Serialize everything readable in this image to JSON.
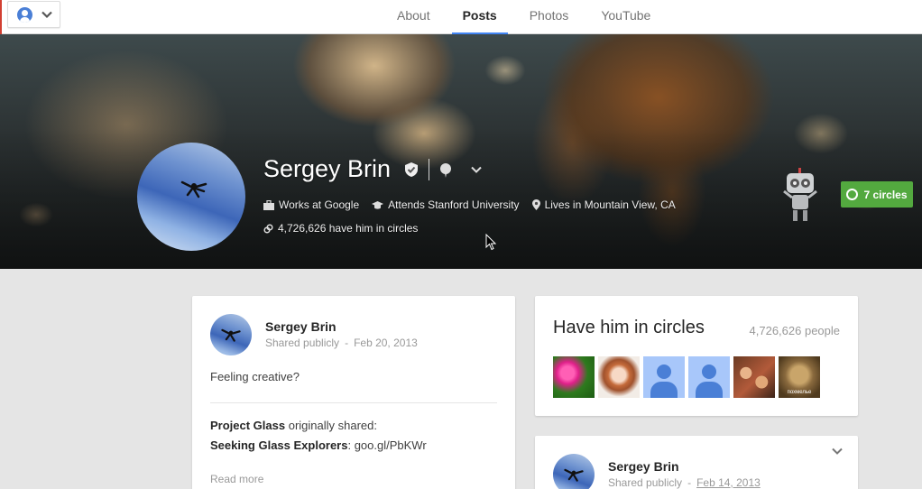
{
  "nav": {
    "tabs": [
      {
        "label": "About"
      },
      {
        "label": "Posts",
        "active": true
      },
      {
        "label": "Photos"
      },
      {
        "label": "YouTube"
      }
    ]
  },
  "profile": {
    "name": "Sergey Brin",
    "work": "Works at Google",
    "school": "Attends Stanford University",
    "location": "Lives in Mountain View, CA",
    "circled_by": "4,726,626 have him in circles",
    "circles_button": "7 circles"
  },
  "post": {
    "author": "Sergey Brin",
    "visibility": "Shared publicly",
    "separator": "-",
    "date": "Feb 20, 2013",
    "text": "Feeling creative?",
    "shared_source": "Project Glass",
    "shared_suffix": "originally shared:",
    "shared_title": "Seeking Glass Explorers",
    "shared_link": ": goo.gl/PbKWr",
    "read_more": "Read more"
  },
  "circles_card": {
    "title": "Have him in circles",
    "count": "4,726,626 people",
    "otter_caption": "похмелье"
  },
  "post2": {
    "author": "Sergey Brin",
    "visibility": "Shared publicly",
    "separator": "-",
    "date": "Feb 14, 2013"
  },
  "colors": {
    "accent_blue": "#4285f4",
    "circles_green": "#53a93f",
    "brand_red": "#d23f31"
  }
}
